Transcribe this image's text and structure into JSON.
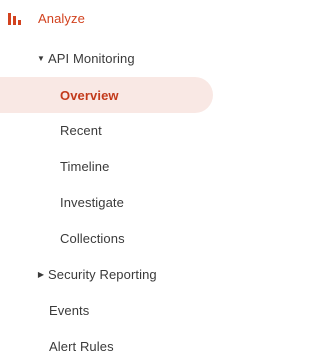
{
  "nav": {
    "analyze": {
      "label": "Analyze",
      "icon": "bar-chart-icon",
      "color": "#d2421f"
    },
    "api_monitoring": {
      "label": "API Monitoring",
      "expanded": true,
      "items": [
        {
          "label": "Overview",
          "active": true
        },
        {
          "label": "Recent",
          "active": false
        },
        {
          "label": "Timeline",
          "active": false
        },
        {
          "label": "Investigate",
          "active": false
        },
        {
          "label": "Collections",
          "active": false
        }
      ]
    },
    "security_reporting": {
      "label": "Security Reporting",
      "expanded": false
    },
    "events": {
      "label": "Events"
    },
    "alert_rules": {
      "label": "Alert Rules"
    }
  },
  "colors": {
    "accent": "#d2421f",
    "active_bg": "#f9e8e4",
    "text": "#3a3a3a"
  }
}
